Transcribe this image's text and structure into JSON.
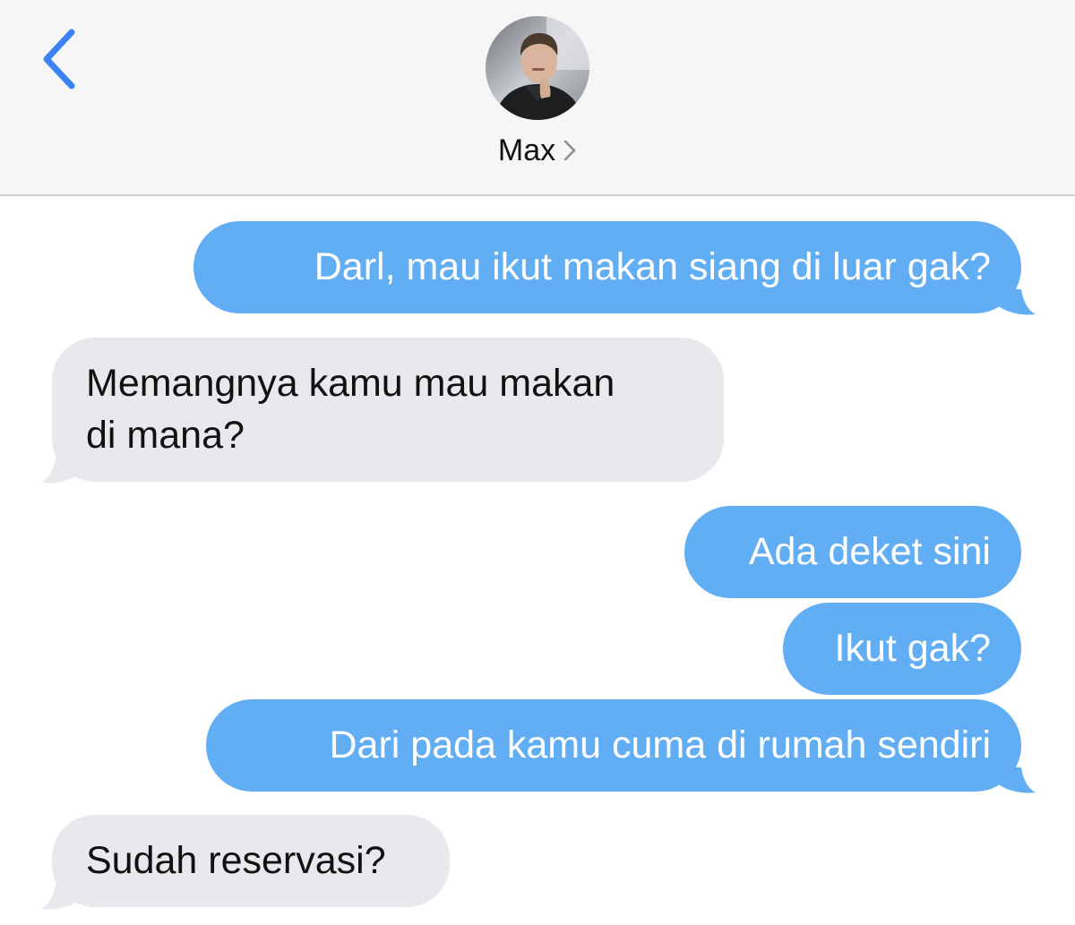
{
  "header": {
    "back_icon": "chevron-left-icon",
    "contact_name": "Max",
    "contact_chevron_icon": "chevron-right-icon",
    "accent_color": "#3a82f6"
  },
  "messages": [
    {
      "direction": "outgoing",
      "text": "Darl, mau ikut makan siang di luar gak?"
    },
    {
      "direction": "incoming",
      "line1": "Memangnya kamu mau makan",
      "line2": "di mana?"
    },
    {
      "direction": "outgoing",
      "text": "Ada deket sini"
    },
    {
      "direction": "outgoing",
      "text": "Ikut gak?"
    },
    {
      "direction": "outgoing",
      "text": "Dari pada kamu cuma di rumah sendiri"
    },
    {
      "direction": "incoming",
      "text": "Sudah reservasi?"
    }
  ],
  "colors": {
    "outgoing_bubble": "#62aef5",
    "incoming_bubble": "#e8e8ed",
    "header_bg": "#f6f6f7"
  }
}
